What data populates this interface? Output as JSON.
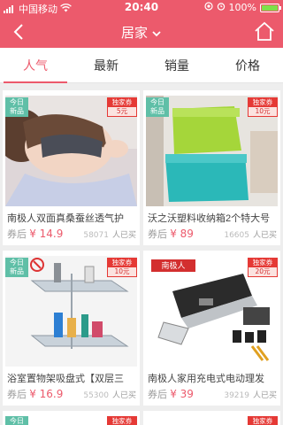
{
  "status": {
    "carrier": "中国移动",
    "time": "20:40",
    "battery": "100%",
    "battery_level": 1.0
  },
  "nav": {
    "title": "居家"
  },
  "tabs": [
    {
      "label": "人气",
      "active": true
    },
    {
      "label": "最新",
      "active": false
    },
    {
      "label": "销量",
      "active": false
    },
    {
      "label": "价格",
      "active": false
    }
  ],
  "badges": {
    "today_line1": "今日",
    "today_line2": "新品",
    "coupon_line1": "独家券"
  },
  "products": [
    {
      "title": "南极人双面真桑蚕丝透气护",
      "after_label": "券后",
      "price": "¥ 14.9",
      "sold": "58071",
      "sold_label": "人已买",
      "coupon": "5元",
      "logo": ""
    },
    {
      "title": "沃之沃塑料收纳箱2个特大号",
      "after_label": "券后",
      "price": "¥ 89",
      "sold": "16605",
      "sold_label": "人已买",
      "coupon": "10元",
      "logo": ""
    },
    {
      "title": "浴室置物架吸盘式【双层三",
      "after_label": "券后",
      "price": "¥ 16.9",
      "sold": "55300",
      "sold_label": "人已买",
      "coupon": "10元",
      "logo": ""
    },
    {
      "title": "南极人家用充电式电动理发",
      "after_label": "券后",
      "price": "¥ 39",
      "sold": "39219",
      "sold_label": "人已买",
      "coupon": "20元",
      "logo": "南极人"
    }
  ],
  "colors": {
    "brand": "#ec5a6c",
    "today_badge": "#5fbfa7",
    "coupon_red": "#e53935"
  }
}
